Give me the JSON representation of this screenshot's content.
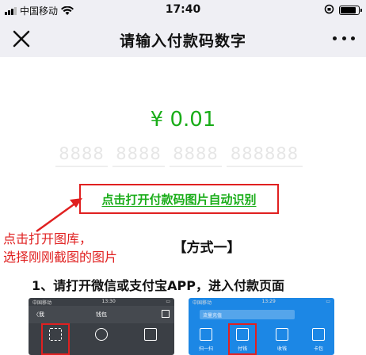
{
  "status_bar": {
    "carrier": "中国移动",
    "time": "17:40"
  },
  "nav": {
    "title": "请输入付款码数字"
  },
  "payment": {
    "amount": "¥ 0.01",
    "code_placeholders": [
      "8888",
      "8888",
      "8888",
      "888888"
    ],
    "auto_recognize_link": "点击打开付款码图片自动识别"
  },
  "annotation": {
    "line1": "点击打开图库，",
    "line2": "选择刚刚截图的图片"
  },
  "instructions": {
    "method_title": "【方式一】",
    "step1": "1、请打开微信或支付宝APP，进入付款页面"
  },
  "thumbs": {
    "wechat": {
      "carrier": "中国移动",
      "time": "13:30",
      "back": "〈我",
      "title": "钱包"
    },
    "alipay": {
      "carrier": "中国移动",
      "time": "13:29",
      "search": "流量充值",
      "items": [
        "扫一扫",
        "付钱",
        "收钱",
        "卡包"
      ]
    }
  },
  "colors": {
    "accent_green": "#1aad19",
    "annotation_red": "#e02020",
    "wechat_dark": "#3b3f45",
    "alipay_blue": "#1c87e5"
  }
}
